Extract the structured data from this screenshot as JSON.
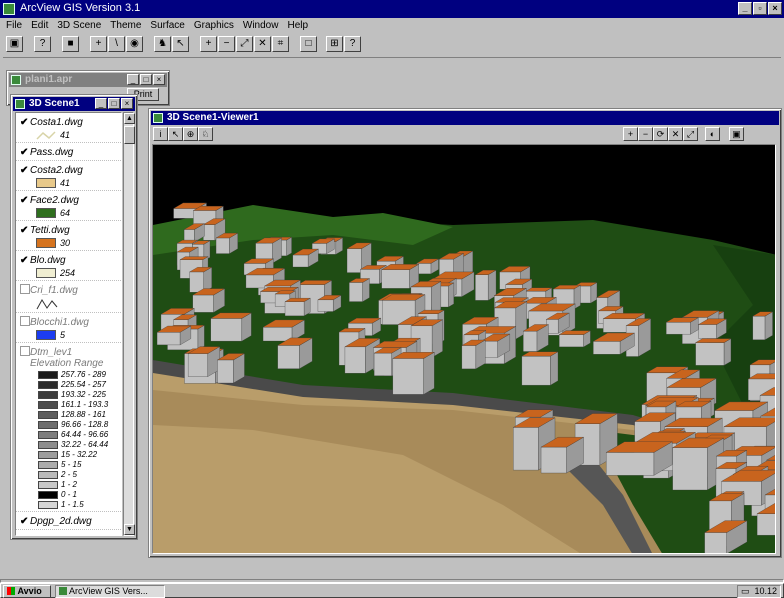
{
  "app": {
    "title": "ArcView GIS Version 3.1"
  },
  "menu": [
    "File",
    "Edit",
    "3D Scene",
    "Theme",
    "Surface",
    "Graphics",
    "Window",
    "Help"
  ],
  "project_window": {
    "title": "plani1.apr",
    "button_label": "Print"
  },
  "toc_window": {
    "title": "3D Scene1",
    "themes": [
      {
        "name": "Costa1.dwg",
        "checked": true,
        "color": "#d8d4a8",
        "symbol": "line",
        "label": "41"
      },
      {
        "name": "Pass.dwg",
        "checked": true
      },
      {
        "name": "Costa2.dwg",
        "checked": true,
        "color": "#e8c98a",
        "symbol": "fill",
        "label": "41"
      },
      {
        "name": "Face2.dwg",
        "checked": true,
        "color": "#2f6f1e",
        "symbol": "fill",
        "label": "64"
      },
      {
        "name": "Tetti.dwg",
        "checked": true,
        "color": "#d5731e",
        "symbol": "fill",
        "label": "30"
      },
      {
        "name": "Blo.dwg",
        "checked": true,
        "color": "#f0eed2",
        "symbol": "fill",
        "label": "254"
      },
      {
        "name": "Cri_f1.dwg",
        "checked": false,
        "symbol": "zigzag"
      },
      {
        "name": "Blocchi1.dwg",
        "checked": false,
        "color": "#1c3cf0",
        "symbol": "fill",
        "label": "5"
      },
      {
        "name": "Dtm_lev1",
        "checked": false,
        "subtitle": "Elevation Range"
      }
    ],
    "elevation_legend": [
      {
        "label": "257.76 - 289",
        "color": "#1a1a1a"
      },
      {
        "label": "225.54 - 257",
        "color": "#2b2b2b"
      },
      {
        "label": "193.32 - 225",
        "color": "#3c3c3c"
      },
      {
        "label": "161.1 - 193.3",
        "color": "#4d4d4d"
      },
      {
        "label": "128.88 - 161",
        "color": "#5e5e5e"
      },
      {
        "label": "96.66 - 128.8",
        "color": "#6e6e6e"
      },
      {
        "label": "64.44 - 96.66",
        "color": "#7e7e7e"
      },
      {
        "label": "32.22 - 64.44",
        "color": "#8e8e8e"
      },
      {
        "label": "15 - 32.22",
        "color": "#9d9d9d"
      },
      {
        "label": "5 - 15",
        "color": "#acacac"
      },
      {
        "label": "2 - 5",
        "color": "#bababa"
      },
      {
        "label": "1 - 2",
        "color": "#c8c8c8"
      },
      {
        "label": "0 - 1",
        "color": "#000000"
      },
      {
        "label": "1 - 1.5",
        "color": "#d6d6d6"
      }
    ],
    "last_item": "Dpgp_2d.dwg"
  },
  "viewer_window": {
    "title": "3D Scene1-Viewer1"
  },
  "taskbar": {
    "start": "Avvio",
    "task": "ArcView GIS Vers...",
    "clock": "10.12"
  },
  "colors": {
    "title_active": "#000080",
    "roof": "#c8641e",
    "wall": "#c2c2c2",
    "ground": "#1f4d14",
    "road": "#4a4a4a",
    "beach": "#b99d6a"
  }
}
